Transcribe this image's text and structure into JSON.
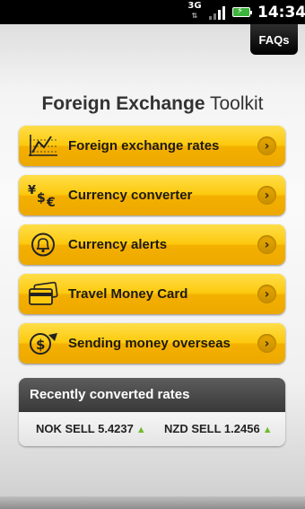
{
  "status_bar": {
    "network": "3G",
    "network_arrows": "⇅",
    "time": "14:34",
    "signal_icon": "signal-icon",
    "battery_icon": "battery-charging-icon"
  },
  "header": {
    "faqs_label": "FAQs"
  },
  "title": {
    "bold": "Foreign Exchange",
    "light": "Toolkit"
  },
  "menu": {
    "items": [
      {
        "label": "Foreign exchange rates",
        "icon": "line-chart-icon"
      },
      {
        "label": "Currency converter",
        "icon": "currency-symbols-icon"
      },
      {
        "label": "Currency alerts",
        "icon": "bell-icon"
      },
      {
        "label": "Travel Money Card",
        "icon": "card-icon"
      },
      {
        "label": "Sending money overseas",
        "icon": "dollar-coin-icon"
      }
    ],
    "chevron": "›"
  },
  "recent": {
    "header": "Recently converted rates",
    "rates": [
      {
        "text": "NOK SELL 5.4237",
        "trend": "up"
      },
      {
        "text": "NZD SELL 1.2456",
        "trend": "up"
      }
    ]
  },
  "colors": {
    "button_gold": "#fcc90d",
    "trend_up": "#6fbe2e",
    "panel_header": "#393939"
  }
}
